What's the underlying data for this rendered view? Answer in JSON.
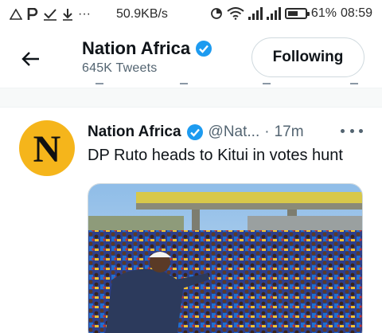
{
  "status_bar": {
    "notif_icons": [
      "warning-triangle-icon",
      "parking-p-icon",
      "check-icon",
      "download-icon"
    ],
    "more": "···",
    "speed": "50.9KB/s",
    "battery_text": "61%",
    "battery_level": 0.61,
    "time": "08:59"
  },
  "header": {
    "name": "Nation Africa",
    "tweets_count": "645K Tweets",
    "follow_label": "Following"
  },
  "tweet": {
    "avatar_letter": "N",
    "author": "Nation Africa",
    "handle": "@Nat...",
    "dot": "·",
    "time": "17m",
    "text": "DP Ruto heads to Kitui in votes hunt"
  },
  "colors": {
    "verified": "#1d9bf0",
    "avatar_bg": "#f5b51b",
    "secondary_text": "#536471"
  }
}
